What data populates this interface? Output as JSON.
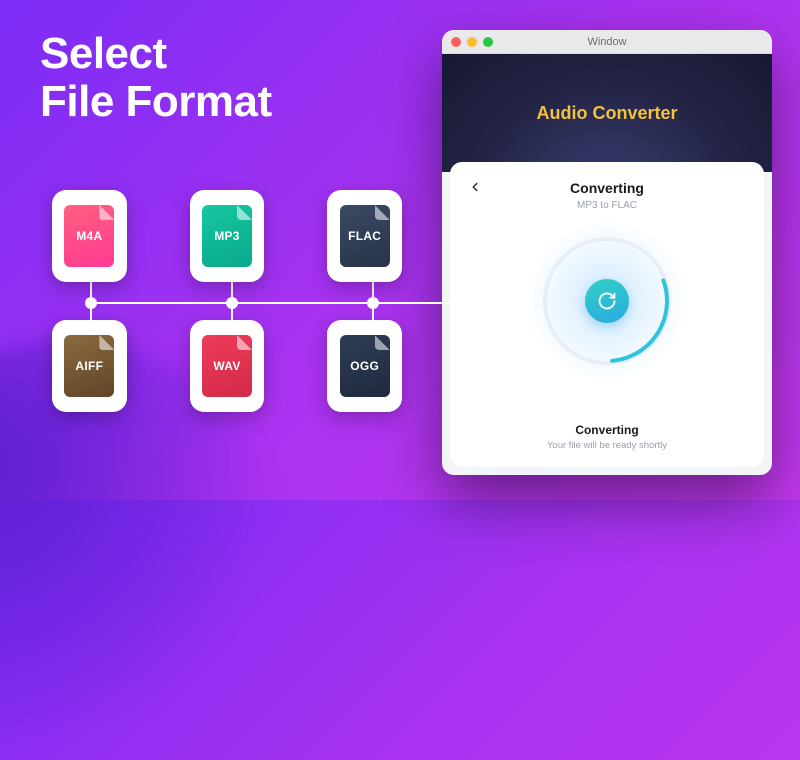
{
  "marketing": {
    "headline_line1": "Select",
    "headline_line2": "File Format"
  },
  "formats": {
    "row1": [
      {
        "label": "M4A",
        "style": "g-m4a"
      },
      {
        "label": "MP3",
        "style": "g-mp3"
      },
      {
        "label": "FLAC",
        "style": "g-flac"
      }
    ],
    "row2": [
      {
        "label": "AIFF",
        "style": "g-aiff"
      },
      {
        "label": "WAV",
        "style": "g-wav"
      },
      {
        "label": "OGG",
        "style": "g-ogg"
      }
    ]
  },
  "window": {
    "title": "Window",
    "hero_title": "Audio Converter",
    "card": {
      "title": "Converting",
      "subtitle": "MP3 to FLAC",
      "footer_title": "Converting",
      "footer_sub": "Your file will be ready shortly"
    }
  },
  "colors": {
    "accent_gradient_start": "#7b2cf5",
    "accent_gradient_end": "#c438ef",
    "hero_text": "#f4c23a"
  }
}
